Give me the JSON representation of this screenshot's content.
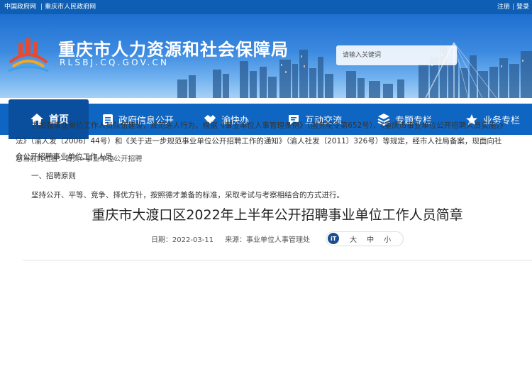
{
  "topbar": {
    "links": [
      "中国政府网",
      "重庆市人民政府网"
    ],
    "register": "注册",
    "login": "登录"
  },
  "header": {
    "title": "重庆市人力资源和社会保障局",
    "domain": "RLSBJ.CQ.GOV.CN",
    "search_placeholder": "请输入关键词"
  },
  "nav": {
    "items": [
      {
        "label": "首页",
        "icon": "home-icon"
      },
      {
        "label": "政府信息公开",
        "icon": "document-icon"
      },
      {
        "label": "渝快办",
        "icon": "handshake-icon"
      },
      {
        "label": "互动交流",
        "icon": "chat-icon"
      },
      {
        "label": "专题专栏",
        "icon": "layers-icon"
      },
      {
        "label": "业务专栏",
        "icon": "star-icon"
      }
    ]
  },
  "breadcrumb": {
    "prefix": "您当前的位置：",
    "home": "首页",
    "sep": ">",
    "current": "事业单位公开招聘"
  },
  "article": {
    "title": "重庆市大渡口区2022年上半年公开招聘事业单位工作人员简章",
    "date": "日期：2022-03-11",
    "source": "来源：事业单位人事管理处",
    "font_icon": "iT",
    "font_sizes": [
      "大",
      "中",
      "小"
    ],
    "paragraph1": "为加强事业单位工作人员队伍建设，规范进人行为，根据《事业单位人事管理条例》（国务院令第652号）、《重庆市事业单位公开招聘人员实施办法》（渝人发〔2006〕44号）和《关于进一步规范事业单位公开招聘工作的通知》（渝人社发〔2011〕326号）等规定，经市人社局备案，现面向社会公开招聘事业单位工作人员。",
    "heading1": "一、招聘原则",
    "paragraph2": "坚持公开、平等、竞争、择优方针，按照德才兼备的标准，采取考试与考察相结合的方式进行。"
  },
  "colors": {
    "nav_blue": "#0f66c2",
    "nav_active": "#0a4f9d",
    "topbar_blue": "#0e5fb4"
  }
}
